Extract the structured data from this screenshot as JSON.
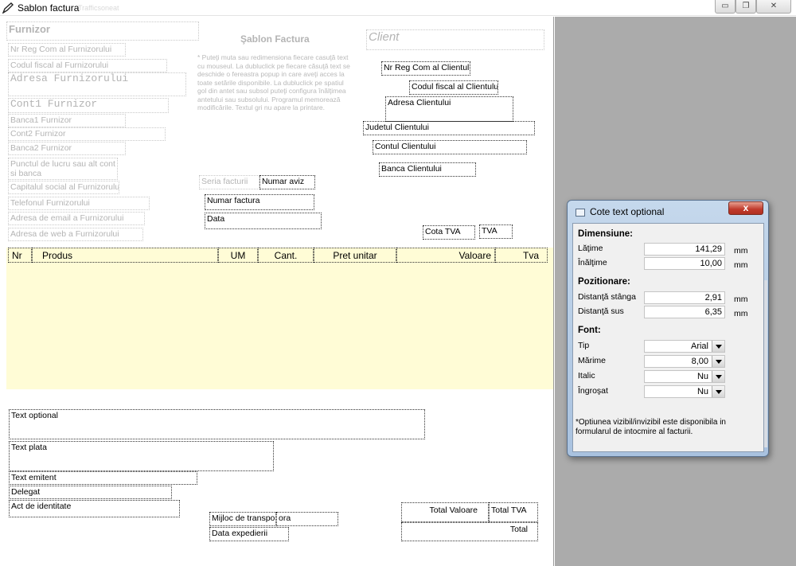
{
  "window": {
    "title": "Sablon factura",
    "ghost_text": "Trafficsoneat",
    "controls": {
      "minimize": "▭",
      "restore": "❐",
      "close": "✕"
    }
  },
  "supplier": {
    "title": "Furnizor",
    "fields": [
      "Nr Reg Com al Furnizorului",
      "Codul fiscal al Furnizorului",
      "Adresa Furnizorului",
      "Cont1 Furnizor",
      "Banca1 Furnizor",
      "Cont2 Furnizor",
      "Banca2 Furnizor",
      "Punctul de lucru sau alt cont si banca",
      "Capitalul social al Furnizorului",
      "Telefonul Furnizorului",
      "Adresa de email a Furnizorului",
      "Adresa de web a Furnizorului"
    ]
  },
  "template_title": "Şablon Factura",
  "note": "* Puteţi muta sau redimensiona fiecare casuţă text cu mouseul. La dubluclick pe fiecare căsuţă text se deschide o fereastra popup in care aveţi acces la toate setările disponibile. La dubluclick pe spatiul gol din antet sau subsol puteţi configura înălţimea antetului sau subsolului. Programul memorează modificările. Textul gri nu apare la printare.",
  "client": {
    "title": "Client",
    "fields": [
      "Nr Reg Com al Clientului",
      "Codul fiscal al Clientului",
      "Adresa Clientului",
      "Judetul Clientului",
      "Contul Clientului",
      "Banca Clientului"
    ]
  },
  "invoice": {
    "series": "Seria facturii",
    "notice_no": "Numar aviz",
    "invoice_no": "Numar factura",
    "date": "Data",
    "vat_rate": "Cota TVA",
    "vat": "TVA"
  },
  "table": {
    "headers": [
      "Nr",
      "Produs",
      "UM",
      "Cant.",
      "Pret unitar",
      "Valoare",
      "Tva"
    ]
  },
  "footer": {
    "optional_text": "Text optional",
    "payment_text": "Text plata",
    "issuer_text": "Text emitent",
    "delegate": "Delegat",
    "id_doc": "Act de identitate",
    "transport": "Mijloc de transpo",
    "hour": "ora",
    "ship_date": "Data expedierii",
    "total_value": "Total Valoare",
    "total_vat": "Total TVA",
    "total": "Total"
  },
  "dialog": {
    "title": "Cote text optional",
    "close": "x",
    "dimensions": {
      "heading": "Dimensiune:",
      "width_label": "Lăţime",
      "width_value": "141,29",
      "height_label": "Înălţime",
      "height_value": "10,00",
      "unit": "mm"
    },
    "position": {
      "heading": "Pozitionare:",
      "left_label": "Distanţă stânga",
      "left_value": "2,91",
      "top_label": "Distanţă sus",
      "top_value": "6,35",
      "unit": "mm"
    },
    "font": {
      "heading": "Font:",
      "type_label": "Tip",
      "type_value": "Arial",
      "size_label": "Mărime",
      "size_value": "8,00",
      "italic_label": "Italic",
      "italic_value": "Nu",
      "bold_label": "Îngroşat",
      "bold_value": "Nu"
    },
    "note": "*Optiunea vizibil/invizibil este disponibila in formularul de intocmire al facturii."
  },
  "colors": {
    "table_background": "#fffcd6",
    "grey_area": "#ababab",
    "ghost_text": "#b4b4b4"
  }
}
